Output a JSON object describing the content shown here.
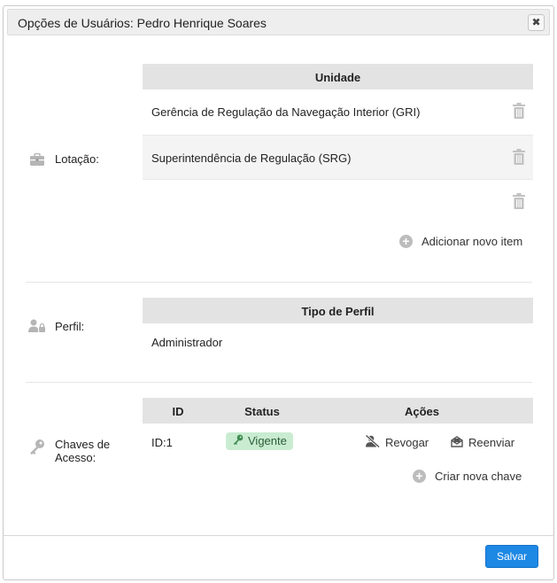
{
  "dialog": {
    "title": "Opções de Usuários: Pedro Henrique Soares",
    "close_label": "✖",
    "save_label": "Salvar"
  },
  "lotacao": {
    "label": "Lotação:",
    "icon": "briefcase-icon",
    "column_header": "Unidade",
    "rows": [
      {
        "unidade": "Gerência de Regulação da Navegação Interior (GRI)"
      },
      {
        "unidade": "Superintendência de Regulação (SRG)"
      },
      {
        "unidade": ""
      }
    ],
    "add_label": "Adicionar novo item"
  },
  "perfil": {
    "label": "Perfil:",
    "icon": "user-lock-icon",
    "column_header": "Tipo de Perfil",
    "value": "Administrador"
  },
  "chaves": {
    "label_line1": "Chaves de",
    "label_line2": "Acesso:",
    "icon": "key-icon",
    "headers": {
      "id": "ID",
      "status": "Status",
      "acoes": "Ações"
    },
    "rows": [
      {
        "id": "ID:1",
        "status": "Vigente",
        "revoke_label": "Revogar",
        "resend_label": "Reenviar"
      }
    ],
    "add_label": "Criar nova chave"
  },
  "colors": {
    "accent": "#1e88e5",
    "status_ok_bg": "#c9ecd1",
    "status_ok_fg": "#2b5d36",
    "header_bg": "#e3e3e3"
  }
}
